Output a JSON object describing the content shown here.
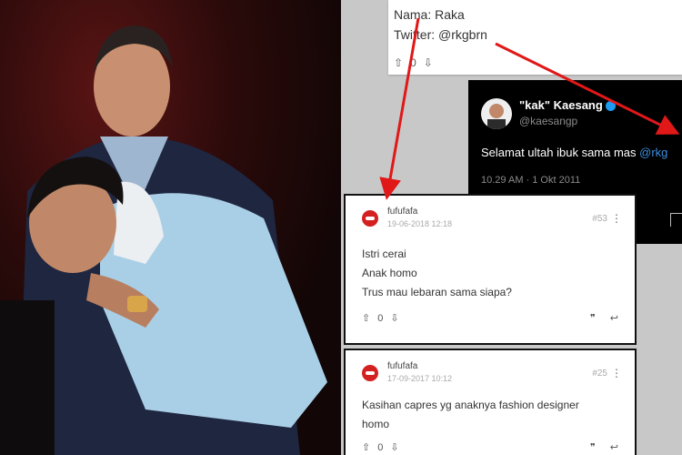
{
  "top_card": {
    "name_line": "Nama: Raka",
    "twitter_line": "Twitter: @rkgbrn",
    "vote_count": "0"
  },
  "tweet": {
    "display_name": "\"kak\" Kaesang",
    "handle": "@kaesangp",
    "text": "Selamat ultah ibuk sama mas ",
    "mention": "@rkg",
    "timestamp": "10.29 AM · 1 Okt 2011"
  },
  "comments": [
    {
      "username": "fufufafa",
      "date": "19-06-2018 12:18",
      "number": "#53",
      "lines": [
        "Istri cerai",
        "Anak homo",
        "Trus mau lebaran sama siapa?"
      ],
      "votes": "0"
    },
    {
      "username": "fufufafa",
      "date": "17-09-2017 10:12",
      "number": "#25",
      "lines": [
        "Kasihan capres yg anaknya fashion designer",
        "homo"
      ],
      "votes": "0"
    }
  ],
  "colors": {
    "arrow": "#e01818",
    "logo": "#d32020",
    "mention": "#3b8fe0"
  }
}
